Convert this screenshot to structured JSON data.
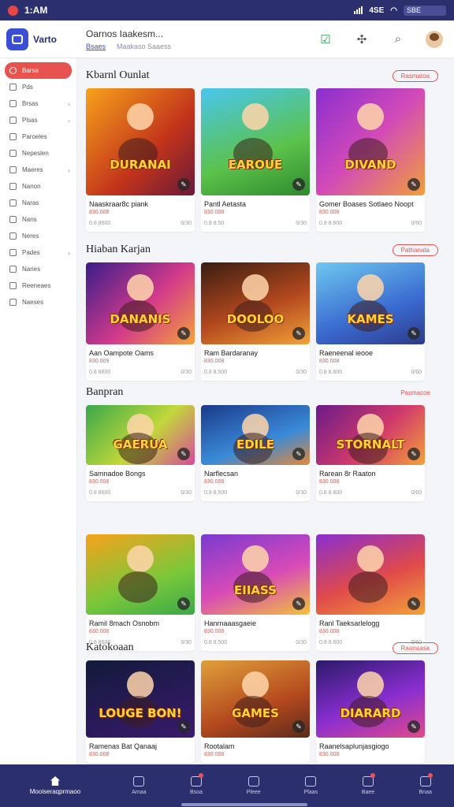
{
  "status": {
    "time": "1:AM",
    "wifi_text": "4SE",
    "battery_text": "SBE"
  },
  "header": {
    "logo_text": "Varto",
    "title": "Oarnos Iaakesm...",
    "tab_active": "Bsaes",
    "tab_other": "Maakaso Saaess"
  },
  "sidebar": {
    "items": [
      {
        "label": "Barsa",
        "active": true,
        "chevron": false
      },
      {
        "label": "Pds",
        "active": false,
        "chevron": false
      },
      {
        "label": "Brsas",
        "active": false,
        "chevron": true
      },
      {
        "label": "Plsas",
        "active": false,
        "chevron": true
      },
      {
        "label": "Paroeles",
        "active": false,
        "chevron": false
      },
      {
        "label": "Nepeslen",
        "active": false,
        "chevron": false
      },
      {
        "label": "Maeres",
        "active": false,
        "chevron": true
      },
      {
        "label": "Nanon",
        "active": false,
        "chevron": false
      },
      {
        "label": "Naras",
        "active": false,
        "chevron": false
      },
      {
        "label": "Nans",
        "active": false,
        "chevron": false
      },
      {
        "label": "Neres",
        "active": false,
        "chevron": false
      },
      {
        "label": "Pades",
        "active": false,
        "chevron": true
      },
      {
        "label": "Naries",
        "active": false,
        "chevron": false
      },
      {
        "label": "Reeneaes",
        "active": false,
        "chevron": false
      },
      {
        "label": "Naeses",
        "active": false,
        "chevron": false
      }
    ]
  },
  "sections": [
    {
      "title": "Kbarnl Ounlat",
      "see_all": "Rasmatoa",
      "see_all_style": "pill",
      "cards": [
        {
          "title": "Naaskraar8c piank",
          "sub": "830.008",
          "meta_l": "0.8  8600",
          "meta_r": "0/30",
          "art": "DURANAI",
          "bg": "linear-gradient(135deg,#f7a21b,#c2331b 60%,#6a1a3a)"
        },
        {
          "title": "Pantl Aetasta",
          "sub": "830.008",
          "meta_l": "0.8  8.50",
          "meta_r": "0/30",
          "art": "EAROUE",
          "bg": "linear-gradient(160deg,#49c6ef,#5bc24a 60%,#2e8a2e)"
        },
        {
          "title": "Gomer Boases Sotlaeo Noopt",
          "sub": "830.008",
          "meta_l": "0.8  8.600",
          "meta_r": "0/60",
          "art": "DIVAND",
          "bg": "linear-gradient(135deg,#8b2ed0,#d24ab8 50%,#f0a03a)"
        }
      ]
    },
    {
      "title": "Hiaban Karjan",
      "see_all": "Pathanata",
      "see_all_style": "pill",
      "cards": [
        {
          "title": "Aan Oampote Oams",
          "sub": "830.009",
          "meta_l": "0.8  8600",
          "meta_r": "0/30",
          "art": "DANANIS",
          "bg": "linear-gradient(135deg,#3a1d8a,#d33a8a 55%,#f4a23a)"
        },
        {
          "title": "Ram Bardaranay",
          "sub": "830.008",
          "meta_l": "0.8  8.500",
          "meta_r": "0/30",
          "art": "DOOLOO",
          "bg": "linear-gradient(160deg,#3a1d12,#b3481e 55%,#f2a23a)"
        },
        {
          "title": "Raeneenal ieooe",
          "sub": "830.008",
          "meta_l": "0.8  8.600",
          "meta_r": "0/60",
          "art": "KAMES",
          "bg": "linear-gradient(160deg,#6ec8f0,#3a6ad0 60%,#2e3a8a)"
        }
      ]
    },
    {
      "title": "Banpran",
      "see_all": "Pasmacoe",
      "see_all_style": "plain",
      "cards": [
        {
          "title": "Samnadoe Bongs",
          "sub": "830.008",
          "meta_l": "0.8  8600",
          "meta_r": "0/30",
          "art": "GAERUA",
          "bg": "linear-gradient(135deg,#3aa84a,#c2d83a 55%,#d84a9a)"
        },
        {
          "title": "Narflecsan",
          "sub": "830.008",
          "meta_l": "0.8  8.500",
          "meta_r": "0/30",
          "art": "EDILE",
          "bg": "linear-gradient(160deg,#1a3a8a,#3a8ad8 60%,#e08a3a)"
        },
        {
          "title": "Rarean 8r Raaton",
          "sub": "830.008",
          "meta_l": "0.8  8.600",
          "meta_r": "0/60",
          "art": "STORNALT",
          "bg": "linear-gradient(135deg,#6a1a8a,#d23a6a 55%,#f2a23a)"
        }
      ]
    },
    {
      "title": "",
      "see_all": "",
      "see_all_style": "none",
      "cards": [
        {
          "title": "Ramil 8mach Osnobm",
          "sub": "830.008",
          "meta_l": "0.8  8600",
          "meta_r": "0/30",
          "art": "",
          "bg": "linear-gradient(160deg,#f7a21b,#7ac83a 60%,#3aa84a)"
        },
        {
          "title": "Hanrnaaasgaeie",
          "sub": "830.008",
          "meta_l": "0.8  8.500",
          "meta_r": "0/30",
          "art": "EIIASS",
          "bg": "linear-gradient(160deg,#7a3ad0,#d84ab8 55%,#f2c23a)"
        },
        {
          "title": "Ranl Taeksarlelogg",
          "sub": "830.008",
          "meta_l": "0.8  8.600",
          "meta_r": "0/60",
          "art": "",
          "bg": "linear-gradient(160deg,#8a2ed0,#e04a4a 55%,#f2a23a)"
        }
      ]
    },
    {
      "title": "Katokoaan",
      "see_all": "Raanaasa",
      "see_all_style": "pill",
      "cards": [
        {
          "title": "Ramenas Bat Qanaaj",
          "sub": "830.008",
          "meta_l": "",
          "meta_r": "",
          "art": "LOUGE BON!",
          "bg": "linear-gradient(160deg,#121a3a,#2a1a5a 60%,#3a1a6a)"
        },
        {
          "title": "Rootalam",
          "sub": "830.008",
          "meta_l": "",
          "meta_r": "",
          "art": "GAMES",
          "bg": "linear-gradient(160deg,#e0a03a,#b3481e 60%,#5a2a1a)"
        },
        {
          "title": "Raanelsaplunjasgiogo",
          "sub": "830.008",
          "meta_l": "",
          "meta_r": "",
          "art": "DIARARD",
          "bg": "linear-gradient(160deg,#2a1a6a,#8a2ed0 55%,#e04a8a)"
        }
      ]
    }
  ],
  "bottomnav": {
    "home": "Mooiseraqprmaoo",
    "items": [
      {
        "label": "Amaa",
        "dot": false
      },
      {
        "label": "Bsoa",
        "dot": true
      },
      {
        "label": "Pleee",
        "dot": false
      },
      {
        "label": "Plaas",
        "dot": false
      },
      {
        "label": "Baee",
        "dot": true
      },
      {
        "label": "Bnaa",
        "dot": true
      }
    ]
  },
  "colors": {
    "brand": "#2b2f6e",
    "accent": "#e8534f",
    "logo": "#3b4fd6"
  }
}
